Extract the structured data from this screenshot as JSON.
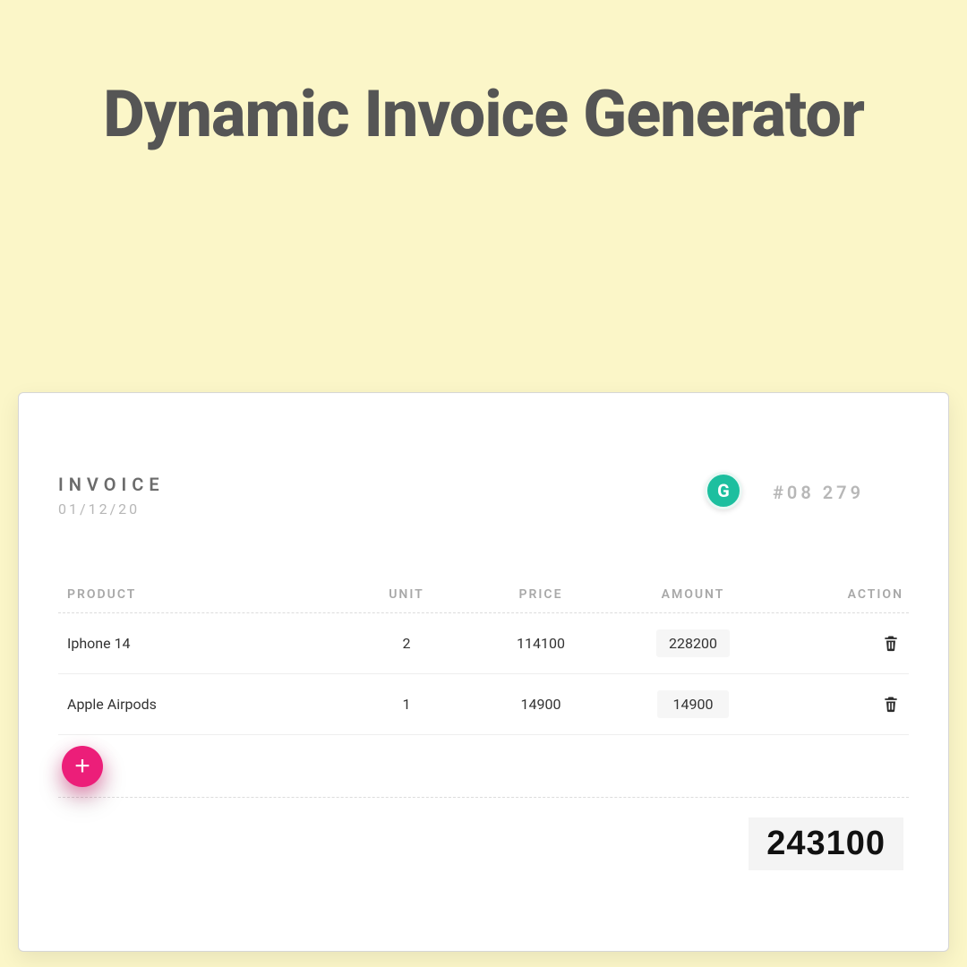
{
  "page": {
    "title": "Dynamic Invoice Generator"
  },
  "invoice": {
    "label": "INVOICE",
    "date": "01/12/20",
    "number": "#08 279",
    "badge_letter": "G"
  },
  "table": {
    "headers": {
      "product": "PRODUCT",
      "unit": "UNIT",
      "price": "PRICE",
      "amount": "AMOUNT",
      "action": "ACTION"
    },
    "rows": [
      {
        "product": "Iphone 14",
        "unit": "2",
        "price": "114100",
        "amount": "228200"
      },
      {
        "product": "Apple Airpods",
        "unit": "1",
        "price": "14900",
        "amount": "14900"
      }
    ],
    "total": "243100"
  },
  "icons": {
    "add": "+"
  }
}
